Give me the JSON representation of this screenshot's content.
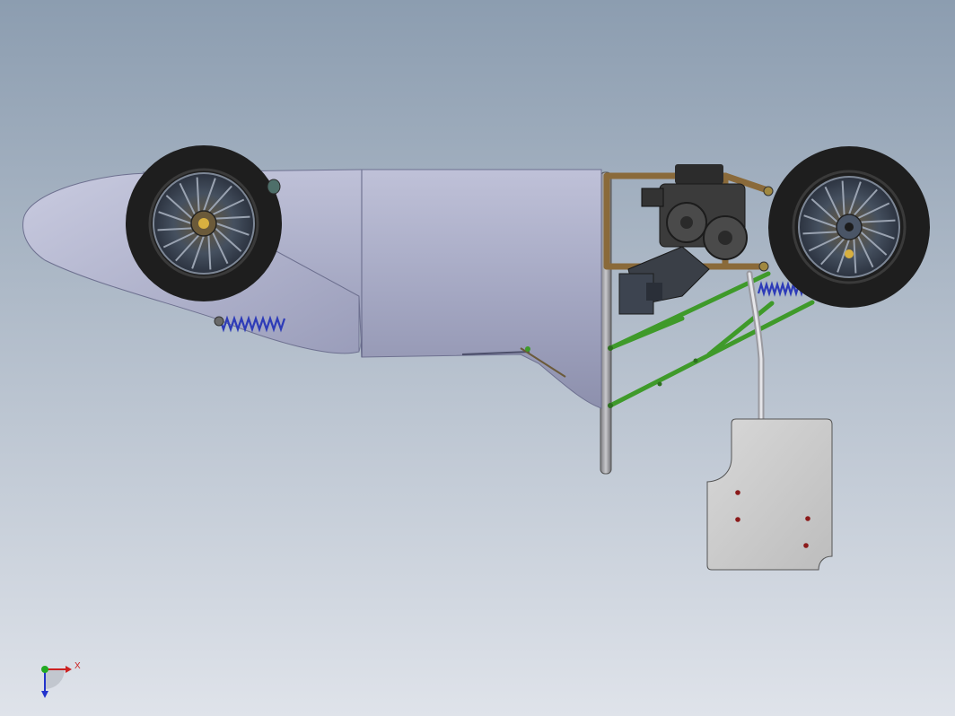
{
  "viewport": {
    "background_top": "#8c9db0",
    "background_bottom": "#dfe3ea"
  },
  "model": {
    "colors": {
      "body_panel": "#a7a9c4",
      "tire": "#1e1e1e",
      "rim": "#4b5668",
      "tube_frame": "#8a6a3a",
      "wishbone": "#3f9a2a",
      "spring": "#2d3bb8",
      "plate": "#c9c9c9",
      "hole": "#8b1a1a"
    }
  },
  "triad": {
    "x_label": "X",
    "x_color": "#cc2222",
    "y_color": "#22aa22",
    "z_color": "#2233cc"
  }
}
